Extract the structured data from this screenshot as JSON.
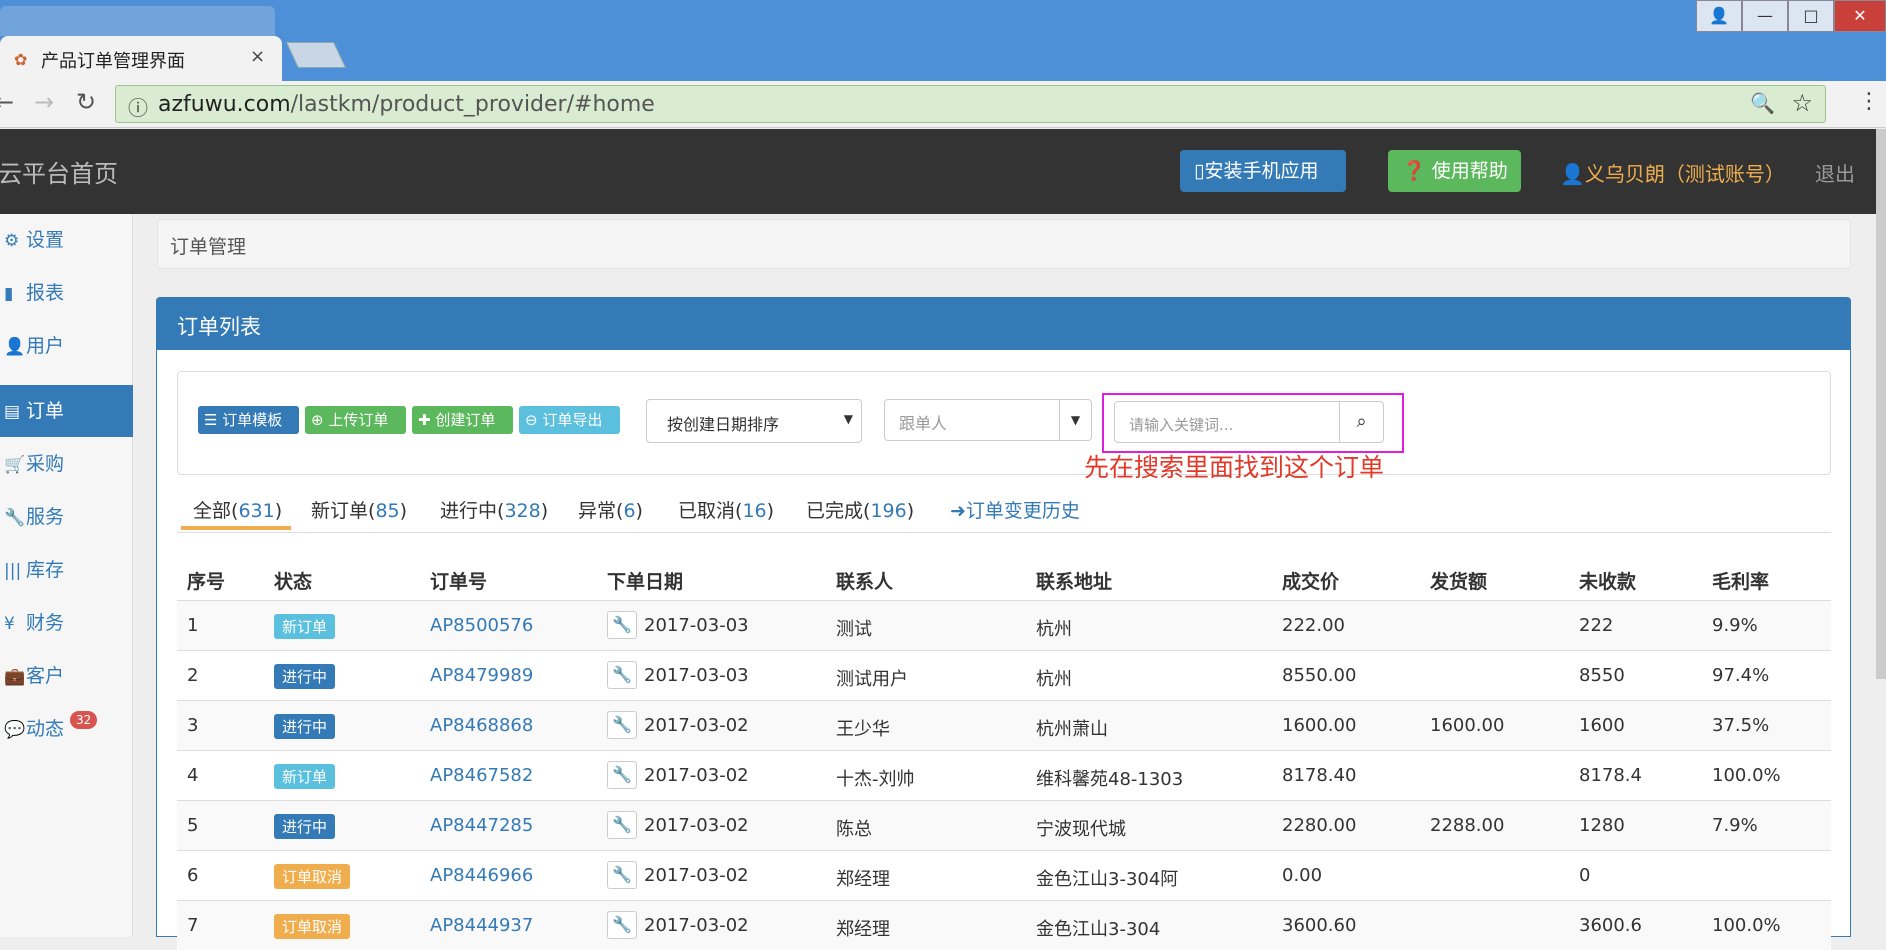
{
  "browser": {
    "tab_title": "产品订单管理界面",
    "tab_close": "×",
    "url_domain": "azfuwu.com",
    "url_path": "/lastkm/product_provider/#home",
    "info": "ⓘ",
    "zoom": "🔍",
    "star": "☆",
    "menu": "⋮",
    "back": "←",
    "forward": "→",
    "reload": "↻",
    "win_user": "👤",
    "win_min": "—",
    "win_max": "□",
    "win_close": "✕"
  },
  "header": {
    "brand": "云平台首页",
    "install_btn": "安装手机应用",
    "help_btn": "使用帮助",
    "user": "义乌贝朗（测试账号）",
    "logout": "退出"
  },
  "sidebar": {
    "items": [
      {
        "label": "设置",
        "icon": "⚙"
      },
      {
        "label": "报表",
        "icon": "▮"
      },
      {
        "label": "用户",
        "icon": "👤"
      },
      {
        "label": "订单",
        "icon": "▤"
      },
      {
        "label": "采购",
        "icon": "🛒"
      },
      {
        "label": "服务",
        "icon": "🔧"
      },
      {
        "label": "库存",
        "icon": "|||"
      },
      {
        "label": "财务",
        "icon": "¥"
      },
      {
        "label": "客户",
        "icon": "💼"
      },
      {
        "label": "动态",
        "icon": "💬"
      }
    ],
    "badge": "32"
  },
  "breadcrumb": "订单管理",
  "panel": {
    "title": "订单列表",
    "buttons": {
      "template": "订单模板",
      "upload": "上传订单",
      "create": "创建订单",
      "export": "订单导出"
    },
    "sort": "按创建日期排序",
    "follow_placeholder": "跟单人",
    "search_placeholder": "请输入关键词...",
    "annotation": "先在搜索里面找到这个订单"
  },
  "tabs": [
    {
      "label": "全部",
      "count": "631"
    },
    {
      "label": "新订单",
      "count": "85"
    },
    {
      "label": "进行中",
      "count": "328"
    },
    {
      "label": "异常",
      "count": "6"
    },
    {
      "label": "已取消",
      "count": "16"
    },
    {
      "label": "已完成",
      "count": "196"
    }
  ],
  "history": "订单变更历史",
  "table": {
    "headers": [
      "序号",
      "状态",
      "订单号",
      "下单日期",
      "联系人",
      "联系地址",
      "成交价",
      "发货额",
      "未收款",
      "毛利率"
    ],
    "rows": [
      {
        "no": "1",
        "status": "新订单",
        "order": "AP8500576",
        "date": "2017-03-03",
        "contact": "测试",
        "addr": "杭州",
        "price": "222.00",
        "ship": "",
        "unpaid": "222",
        "margin": "9.9%"
      },
      {
        "no": "2",
        "status": "进行中",
        "order": "AP8479989",
        "date": "2017-03-03",
        "contact": "测试用户",
        "addr": "杭州",
        "price": "8550.00",
        "ship": "",
        "unpaid": "8550",
        "margin": "97.4%"
      },
      {
        "no": "3",
        "status": "进行中",
        "order": "AP8468868",
        "date": "2017-03-02",
        "contact": "王少华",
        "addr": "杭州萧山",
        "price": "1600.00",
        "ship": "1600.00",
        "unpaid": "1600",
        "margin": "37.5%"
      },
      {
        "no": "4",
        "status": "新订单",
        "order": "AP8467582",
        "date": "2017-03-02",
        "contact": "十杰-刘帅",
        "addr": "维科馨苑48-1303",
        "price": "8178.40",
        "ship": "",
        "unpaid": "8178.4",
        "margin": "100.0%"
      },
      {
        "no": "5",
        "status": "进行中",
        "order": "AP8447285",
        "date": "2017-03-02",
        "contact": "陈总",
        "addr": "宁波现代城",
        "price": "2280.00",
        "ship": "2288.00",
        "unpaid": "1280",
        "margin": "7.9%"
      },
      {
        "no": "6",
        "status": "订单取消",
        "order": "AP8446966",
        "date": "2017-03-02",
        "contact": "郑经理",
        "addr": "金色江山3-304阿",
        "price": "0.00",
        "ship": "",
        "unpaid": "0",
        "margin": ""
      },
      {
        "no": "7",
        "status": "订单取消",
        "order": "AP8444937",
        "date": "2017-03-02",
        "contact": "郑经理",
        "addr": "金色江山3-304",
        "price": "3600.60",
        "ship": "",
        "unpaid": "3600.6",
        "margin": "100.0%"
      }
    ]
  }
}
